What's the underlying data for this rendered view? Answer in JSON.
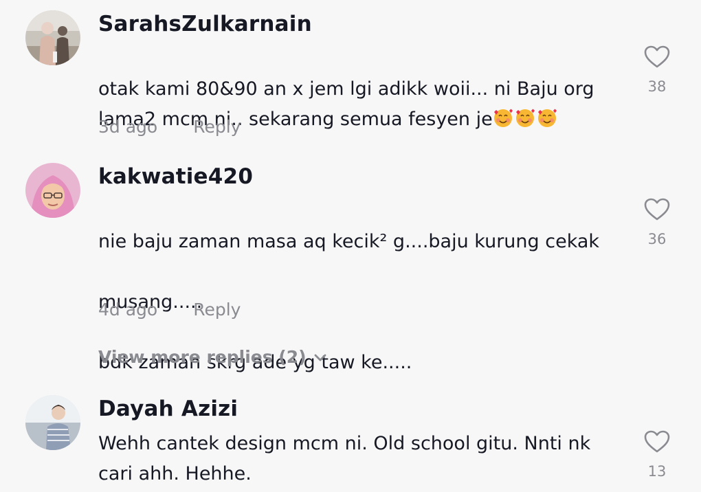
{
  "comments": [
    {
      "username": "SarahsZulkarnain",
      "text": "otak kami 80&90 an x jem lgi adikk woii... ni Baju org lama2 mcm ni.. sekarang semua fesyen je",
      "emoji": [
        "smiling-face-with-hearts",
        "smiling-face-with-hearts",
        "smiling-face-with-hearts"
      ],
      "time": "3d ago",
      "reply_label": "Reply",
      "likes": "38",
      "like_icon": "heart-outline-icon"
    },
    {
      "username": "kakwatie420",
      "text_line1": "nie baju zaman masa aq kecik² g....baju kurung cekak",
      "text_line2": "musang.....",
      "text_line3": "bdk zaman skrg ade yg taw ke.....",
      "time": "4d ago",
      "reply_label": "Reply",
      "likes": "36",
      "like_icon": "heart-outline-icon"
    },
    {
      "username": "Dayah Azizi",
      "text": "Wehh cantek design mcm ni. Old school gitu. Nnti nk cari ahh. Hehhe.",
      "likes": "13",
      "like_icon": "heart-outline-icon"
    }
  ],
  "view_more_replies": "View more replies (2)",
  "colors": {
    "background": "#f7f7f7",
    "primary_text": "#161823",
    "secondary_text": "#8a8b91"
  }
}
